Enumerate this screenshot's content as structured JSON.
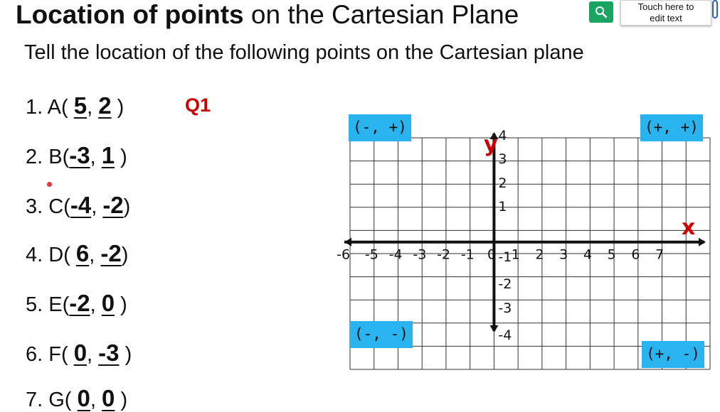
{
  "title": {
    "bold": "Location of points",
    "rest": " on the Cartesian Plane"
  },
  "tooltip": {
    "line1": "Touch here to",
    "line2": "edit text"
  },
  "subtitle": "Tell the location of the following points on the Cartesian plane",
  "q_badge": "Q1",
  "items": [
    {
      "prefix": "1. A(",
      "x": "5",
      "sep": ",",
      "y": "2",
      "suffix": ")"
    },
    {
      "prefix": "2. B(",
      "x": "-3",
      "sep": ",",
      "y": "1",
      "suffix": ")"
    },
    {
      "prefix": "3. C(",
      "x": "-4",
      "sep": ",",
      "y": "-2",
      "suffix": ")"
    },
    {
      "prefix": "4. D(",
      "x": "6",
      "sep": ",",
      "y": "-2",
      "suffix": ")"
    },
    {
      "prefix": "5. E(",
      "x": "-2",
      "sep": ",",
      "y": "0",
      "suffix": ")"
    },
    {
      "prefix": "6. F(",
      "x": "0",
      "sep": ",",
      "y": "-3",
      "suffix": ")"
    },
    {
      "prefix": "7. G(",
      "x": "0",
      "sep": ",",
      "y": "0",
      "suffix": ")"
    }
  ],
  "quadrants": {
    "q2": "(-, +)",
    "q1": "(+, +)",
    "q3": "(-, -)",
    "q4": "(+, -)"
  },
  "axes": {
    "x_label": "x",
    "y_label": "y",
    "x_ticks": [
      "-6",
      "-5",
      "-4",
      "-3",
      "-2",
      "-1",
      "0",
      "1",
      "2",
      "3",
      "4",
      "5",
      "6",
      "7"
    ],
    "y_ticks": [
      "4",
      "3",
      "2",
      "1",
      "-1",
      "-2",
      "-3",
      "-4"
    ]
  },
  "colors": {
    "accent_red": "#cc0000",
    "quadrant_bg": "#29b4f0",
    "search_green": "#19a463"
  },
  "icons": {
    "search": "search-icon"
  }
}
